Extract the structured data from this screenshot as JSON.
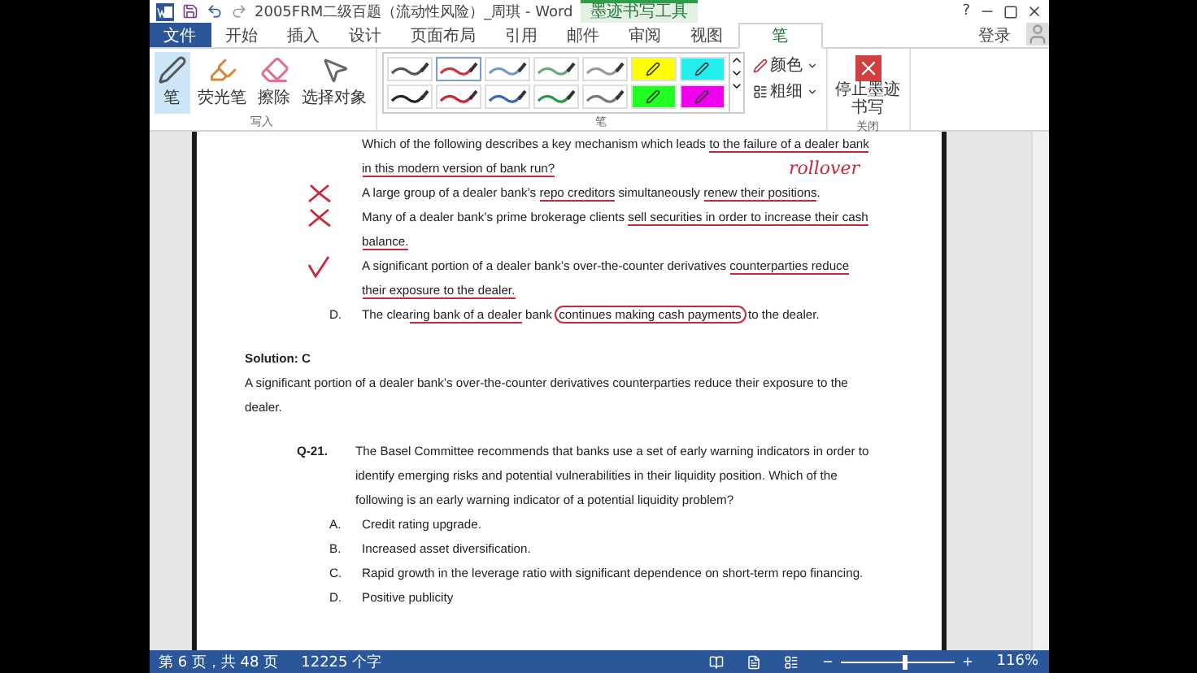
{
  "title_bar": {
    "title": "2005FRM二级百题（流动性风险）_周琪 - Word",
    "context_tab": "墨迹书写工具",
    "help": "?"
  },
  "tabs": [
    {
      "label": "文件",
      "kind": "file",
      "selected": false
    },
    {
      "label": "开始",
      "kind": "tab",
      "selected": false
    },
    {
      "label": "插入",
      "kind": "tab",
      "selected": false
    },
    {
      "label": "设计",
      "kind": "tab",
      "selected": false
    },
    {
      "label": "页面布局",
      "kind": "tab",
      "selected": false
    },
    {
      "label": "引用",
      "kind": "tab",
      "selected": false
    },
    {
      "label": "邮件",
      "kind": "tab",
      "selected": false
    },
    {
      "label": "审阅",
      "kind": "tab",
      "selected": false
    },
    {
      "label": "视图",
      "kind": "tab",
      "selected": false
    },
    {
      "label": "笔",
      "kind": "tab",
      "selected": true
    }
  ],
  "sign_in": "登录",
  "ribbon": {
    "write_group": {
      "label": "写入",
      "tools": [
        {
          "label": "笔",
          "kind": "pen",
          "selected": true
        },
        {
          "label": "荧光笔",
          "kind": "highlighter",
          "selected": false
        },
        {
          "label": "擦除",
          "kind": "eraser",
          "selected": false
        },
        {
          "label": "选择对象",
          "kind": "select",
          "selected": false
        }
      ]
    },
    "pens_group": {
      "label": "笔",
      "pens": [
        {
          "kind": "pen",
          "color": "#555555",
          "selected": false
        },
        {
          "kind": "pen",
          "color": "#cc3344",
          "selected": true
        },
        {
          "kind": "pen",
          "color": "#7799cc",
          "selected": false
        },
        {
          "kind": "pen",
          "color": "#66aa77",
          "selected": false
        },
        {
          "kind": "pen",
          "color": "#999999",
          "selected": false
        },
        {
          "kind": "highlighter",
          "color": "#ffff00",
          "selected": false
        },
        {
          "kind": "highlighter",
          "color": "#22eeee",
          "selected": false
        },
        {
          "kind": "pen",
          "color": "#222222",
          "selected": false
        },
        {
          "kind": "pen",
          "color": "#cc2233",
          "selected": false
        },
        {
          "kind": "pen",
          "color": "#3366bb",
          "selected": false
        },
        {
          "kind": "pen",
          "color": "#229944",
          "selected": false
        },
        {
          "kind": "pen",
          "color": "#777777",
          "selected": false
        },
        {
          "kind": "highlighter",
          "color": "#22ff22",
          "selected": false
        },
        {
          "kind": "highlighter",
          "color": "#ee00ee",
          "selected": false
        }
      ],
      "color_label": "颜色",
      "weight_label": "粗细"
    },
    "close_group": {
      "label": "关闭",
      "stop_label": "停止墨迹书写"
    }
  },
  "document": {
    "question": {
      "stem": [
        {
          "text": "Which of the following describes a key mechanism which leads ",
          "underlined": false,
          "circled": false
        },
        {
          "text": "to the failure of a dealer bank in this modern version of bank run?",
          "underlined": true,
          "circled": false
        }
      ],
      "note": "rollover",
      "options": [
        {
          "crossed": true,
          "ticked": false,
          "segments": [
            {
              "text": "A large group of a dealer bank’s ",
              "underlined": false,
              "circled": false
            },
            {
              "text": "repo creditors",
              "underlined": true,
              "circled": false
            },
            {
              "text": " simultaneously ",
              "underlined": false,
              "circled": false
            },
            {
              "text": "renew their positions",
              "underlined": true,
              "circled": false
            },
            {
              "text": ".",
              "underlined": false,
              "circled": false
            }
          ]
        },
        {
          "crossed": true,
          "ticked": false,
          "segments": [
            {
              "text": "Many of a dealer bank’s prime brokerage clients ",
              "underlined": false,
              "circled": false
            },
            {
              "text": "sell securities in order to increase their cash balance.",
              "underlined": true,
              "circled": false
            }
          ]
        },
        {
          "crossed": false,
          "ticked": true,
          "segments": [
            {
              "text": "A significant portion of a dealer bank’s over-the-counter derivatives ",
              "underlined": false,
              "circled": false
            },
            {
              "text": "counterparties reduce their exposure to the dealer.",
              "underlined": true,
              "circled": false
            }
          ]
        },
        {
          "label": "D.",
          "crossed": false,
          "ticked": false,
          "segments": [
            {
              "text": "The clea",
              "underlined": false,
              "circled": false
            },
            {
              "text": "ring bank of a dealer",
              "underlined": true,
              "circled": false
            },
            {
              "text": " bank ",
              "underlined": false,
              "circled": false
            },
            {
              "text": "continues making cash payments",
              "underlined": false,
              "circled": true
            },
            {
              "text": " to the dealer.",
              "underlined": false,
              "circled": false
            }
          ]
        }
      ]
    },
    "solution": {
      "heading": "Solution: C",
      "text": "A significant portion of a dealer bank’s over-the-counter derivatives counterparties reduce their exposure to the dealer."
    },
    "question_2": {
      "number": "Q-21.",
      "stem": "The Basel Committee recommends that banks use a set of early warning indicators in order to identify emerging risks and potential vulnerabilities in their liquidity position. Which of the following is an early warning indicator of a potential liquidity problem?",
      "options": [
        {
          "label": "A.",
          "text": "Credit rating upgrade."
        },
        {
          "label": "B.",
          "text": "Increased asset diversification."
        },
        {
          "label": "C.",
          "text": "Rapid growth in the leverage ratio with significant dependence on short-term repo financing."
        },
        {
          "label": "D.",
          "text": "Positive publicity"
        }
      ]
    }
  },
  "status_bar": {
    "page": "第 6 页，共 48 页",
    "words": "12225 个字",
    "zoom": {
      "level": 0.55
    },
    "zoom_text": "116%"
  }
}
